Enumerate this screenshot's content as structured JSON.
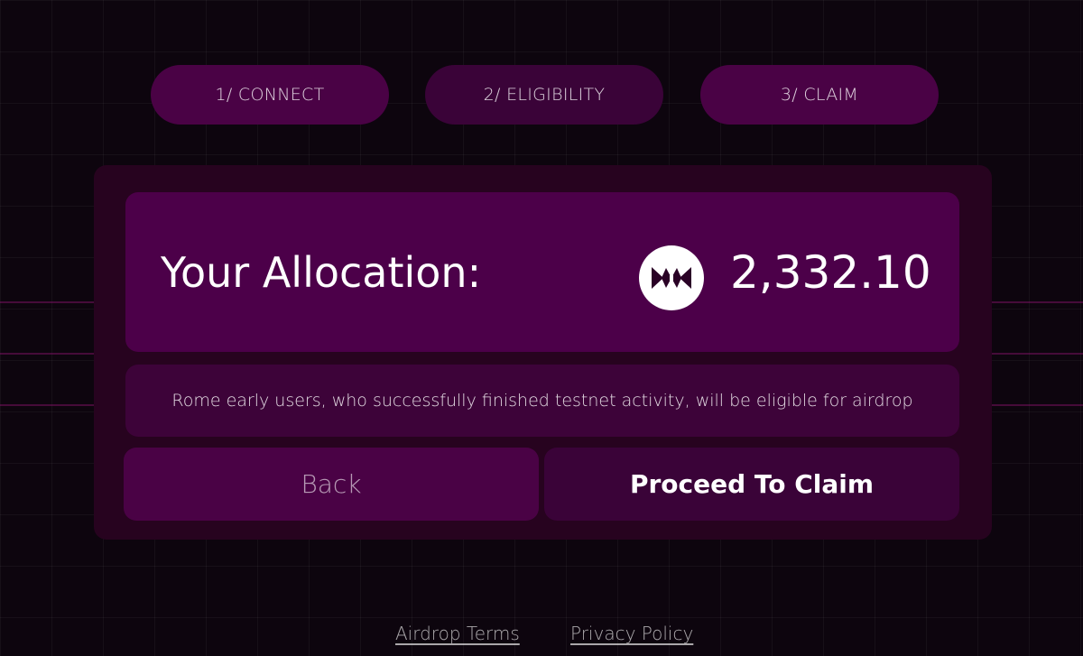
{
  "steps": [
    {
      "label": "1/ CONNECT"
    },
    {
      "label": "2/ ELIGIBILITY"
    },
    {
      "label": "3/ CLAIM"
    }
  ],
  "allocation": {
    "label": "Your Allocation:",
    "value": "2,332.10",
    "token_icon": "rome-token-icon"
  },
  "info": {
    "text": "Rome early users, who successfully finished testnet activity, will be eligible for airdrop"
  },
  "buttons": {
    "back_label": "Back",
    "claim_label": "Proceed To Claim"
  },
  "footer": {
    "terms_label": "Airdrop Terms",
    "privacy_label": "Privacy Policy"
  },
  "colors": {
    "background": "#0d050e",
    "card": "#27031f",
    "panel": "#4c0049",
    "accent_dark": "#3a0338"
  }
}
